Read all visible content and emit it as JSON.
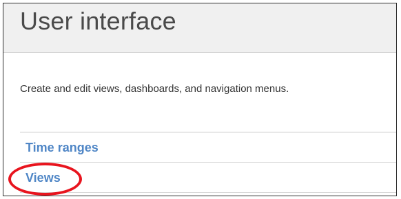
{
  "header": {
    "title": "User interface"
  },
  "main": {
    "description": "Create and edit views, dashboards, and navigation menus.",
    "links": [
      {
        "label": "Time ranges"
      },
      {
        "label": "Views"
      }
    ]
  },
  "annotation": {
    "highlight_color": "#e8141e",
    "highlighted_item": "Views"
  },
  "colors": {
    "link": "#4f86c6",
    "header_background": "#f0f0f0",
    "title_text": "#4a4a4a"
  }
}
